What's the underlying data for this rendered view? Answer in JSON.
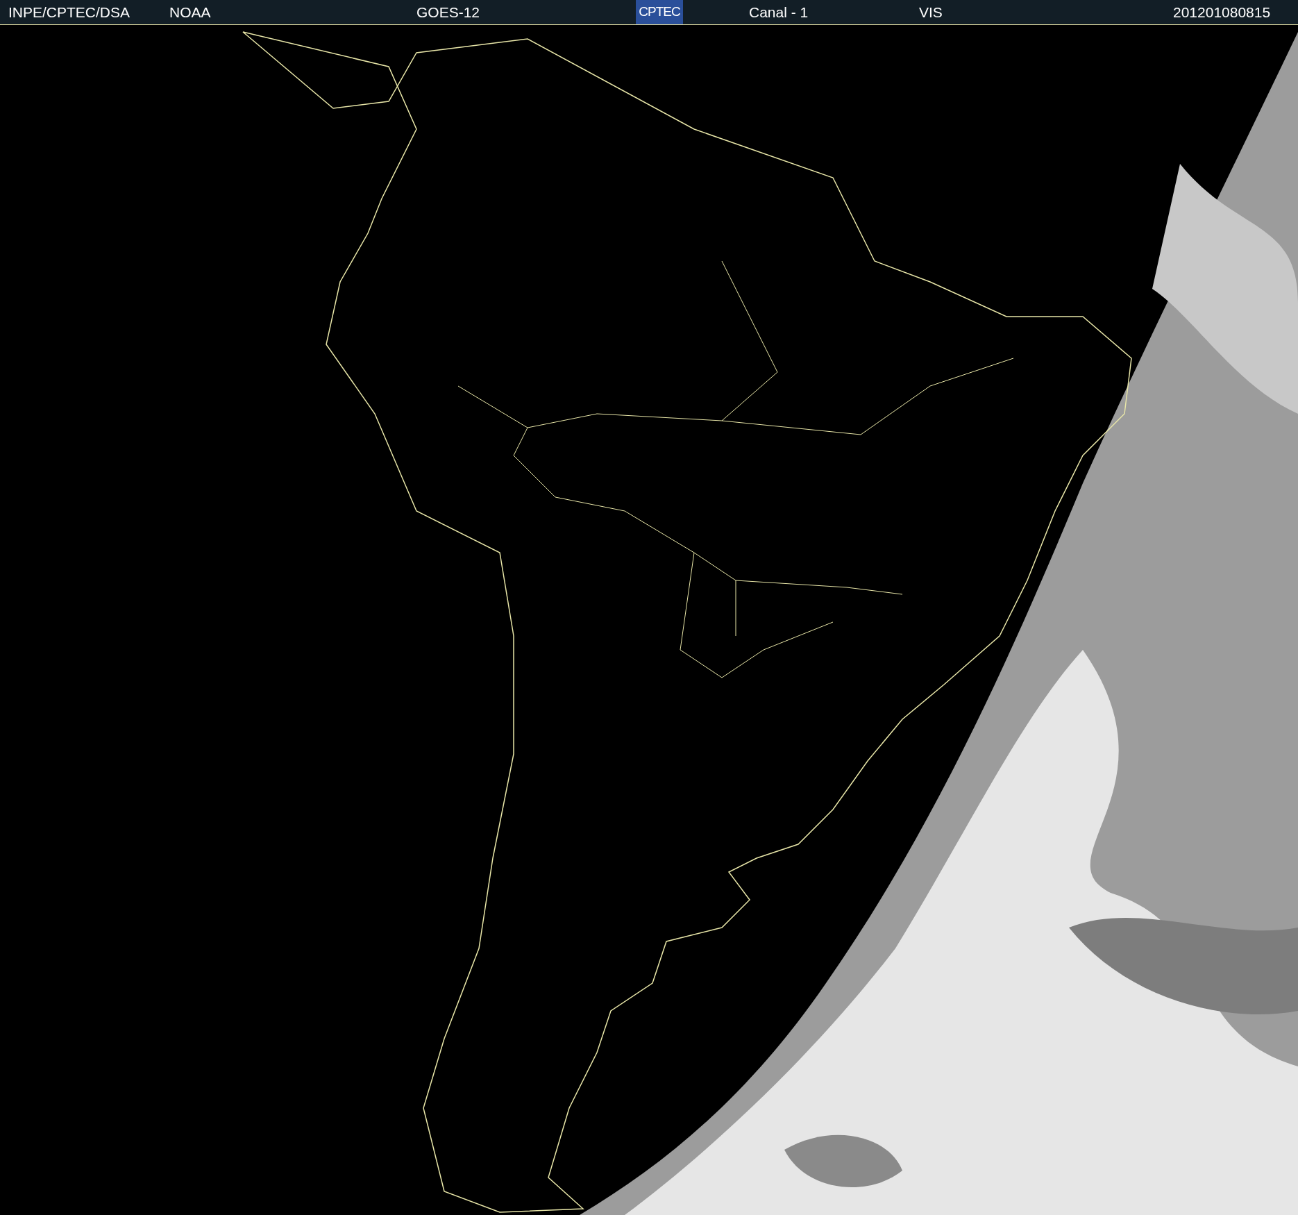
{
  "header": {
    "items": [
      {
        "kind": "text",
        "text": "INPE/CPTEC/DSA"
      },
      {
        "kind": "text",
        "text": "NOAA"
      },
      {
        "kind": "text",
        "text": "GOES-12"
      },
      {
        "kind": "logo",
        "text": "CPTEC"
      },
      {
        "kind": "text",
        "text": "Canal - 1"
      },
      {
        "kind": "text",
        "text": "VIS"
      },
      {
        "kind": "text",
        "text": "201201080815"
      }
    ]
  }
}
